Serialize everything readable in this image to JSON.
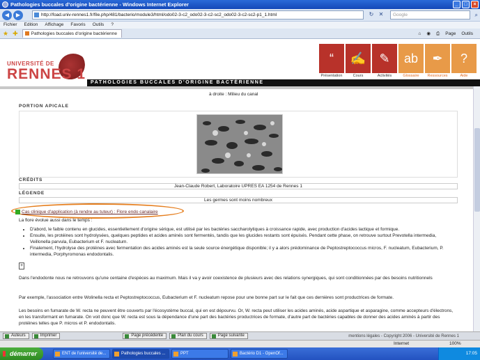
{
  "window": {
    "title": "Pathologies buccales d'origine bactérienne - Windows Internet Explorer",
    "buttons": [
      "_",
      "□",
      "×"
    ]
  },
  "address": {
    "url": "http://foad.univ-rennes1.fr/file.php/481/bacterio/module3/html/odo02-3-c2_odo02-3-c2-sc2_odo02-3-c2-sc2-p1_1.html",
    "search_placeholder": "Google"
  },
  "menu": [
    "Fichier",
    "Edition",
    "Affichage",
    "Favoris",
    "Outils",
    "?"
  ],
  "tab": {
    "label": "Pathologies buccales d'origine bactérienne"
  },
  "toolbar": {
    "page_label": "Page",
    "tools_label": "Outils"
  },
  "site": {
    "logo_top": "UNIVERSITÉ DE",
    "logo_main": "RENNES 1",
    "banner": "PATHOLOGIES BUCCALES D'ORIGINE BACTÉRIENNE",
    "nav": [
      {
        "label": "Présentation",
        "icon": "“",
        "color": "#b8322a"
      },
      {
        "label": "Cours",
        "icon": "✍",
        "color": "#b8322a"
      },
      {
        "label": "Activités",
        "icon": "✎",
        "color": "#b8322a"
      },
      {
        "label": "Glossaire",
        "icon": "ab",
        "color": "#e89a48"
      },
      {
        "label": "Ressources",
        "icon": "✒",
        "color": "#e89a48"
      },
      {
        "label": "Aide",
        "icon": "?",
        "color": "#e89a48"
      }
    ]
  },
  "content": {
    "cut_text": "à droite : Milieu du canal",
    "portion_title": "PORTION APICALE",
    "credits_title": "CRÉDITS",
    "credits_value": "Jean-Claude Robert, Laboratoire UPRES EA 1254 de Rennes 1",
    "legend_title": "LÉGENDE",
    "legend_value": "Les germes sont moins nombreux",
    "case_link": "Cas clinique d'application (à rendre au tuteur) : Flore endo canalaire",
    "intro": "La flore évolue aussi dans le temps :",
    "bullets": [
      "D'abord, le faible contenu en glucides, essentiellement d'origine sérique, est utilisé par les bactéries saccharolytiques à croissance rapide, avec production d'acides lactique et formique.",
      "Ensuite, les protéines sont hydrolysées, quelques peptides et acides aminés sont fermentés, tandis que les glucides restants sont épuisés. Pendant cette phase, on retrouve surtout Prevotella intermedia, Veillonella parvula, Eubacterium et F. nucleatum.",
      "Finalement, l'hydrolyse des protéines avec fermentation des acides aminés est la seule source énergétique disponible; il y a alors prédominance de Peptostreptococcus micros, F. nucleatum, Eubacterium, P. intermedia, Porphyromonas endodontalis."
    ],
    "para1": "Dans l'endodonte nous ne retrouvons qu'une centaine d'espèces au maximum. Mais il va y avoir coexistence de plusieurs avec des relations synergiques, qui sont conditionnées par des besoins nutritionnels",
    "para2": "Par exemple, l'association entre Wolinella recta et Peptostreptococcus, Eubacterium et F. nucleatum repose pour une bonne part sur le fait que ces dernières sont productrices de formate.",
    "para3": "Les besoins en fumarate de W. recta ne peuvent être couverts par l'écosystème buccal, qui en est dépourvu. Or, W. recta peut utiliser les acides aminés, acide aspartique et asparagine, comme accepteurs d'électrons, en les transformant en fumarate. On voit donc que W. recta est sous la dépendance d'une part des bactéries productrices de formate, d'autre part de bactéries capables de donner des acides aminés à partir des protéines telles que P. micros et P. endodontalis."
  },
  "pagenav": {
    "authors": "Auteurs",
    "print": "Imprimer",
    "prev": "Page précédente",
    "plan": "Plan du cours",
    "next": "Page suivante",
    "copyright": "mentions légales - Copyright 2006 - Université de Rennes 1"
  },
  "status": {
    "zone": "Internet",
    "zoom": "100%"
  },
  "taskbar": {
    "start": "démarrer",
    "tasks": [
      "ENT de l'université de...",
      "Pathologies buccales ...",
      "PPT",
      "Bactério D1 - OpenOf..."
    ],
    "clock": "17:05"
  }
}
